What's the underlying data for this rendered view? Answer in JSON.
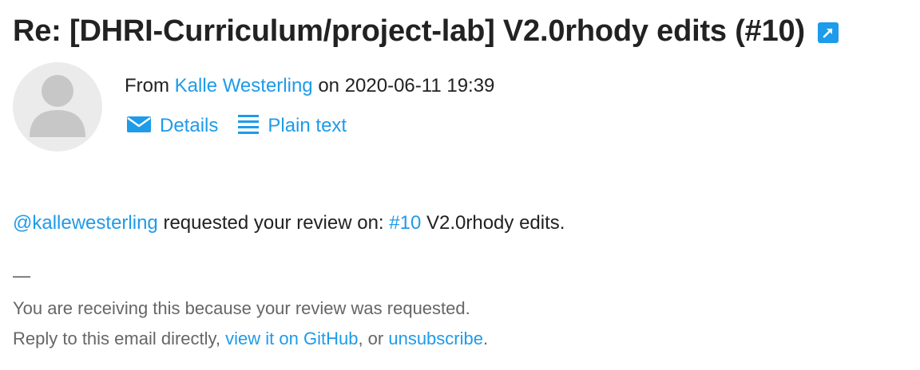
{
  "email": {
    "subject": "Re: [DHRI-Curriculum/project-lab] V2.0rhody edits (#10)",
    "from_prefix": "From",
    "sender_name": "Kalle Westerling",
    "date_prefix": "on",
    "date": "2020-06-11 19:39",
    "actions": {
      "details": "Details",
      "plain_text": "Plain text"
    },
    "body": {
      "mention": "@kallewesterling",
      "text_middle": " requested your review on: ",
      "pr_link": "#10",
      "pr_title": " V2.0rhody edits."
    },
    "footer": {
      "dash": "—",
      "reason": "You are receiving this because your review was requested.",
      "reply_prefix": "Reply to this email directly, ",
      "view_link": "view it on GitHub",
      "or_text": ", or ",
      "unsubscribe_link": "unsubscribe",
      "end_period": "."
    }
  },
  "colors": {
    "link": "#1e9be9",
    "text": "#222222",
    "muted": "#666666",
    "avatar_bg": "#ebebeb",
    "avatar_fg": "#c7c7c7"
  },
  "icons": {
    "external_link": "external-link-icon",
    "envelope": "envelope-icon",
    "list": "list-icon",
    "avatar": "user-avatar-icon"
  }
}
